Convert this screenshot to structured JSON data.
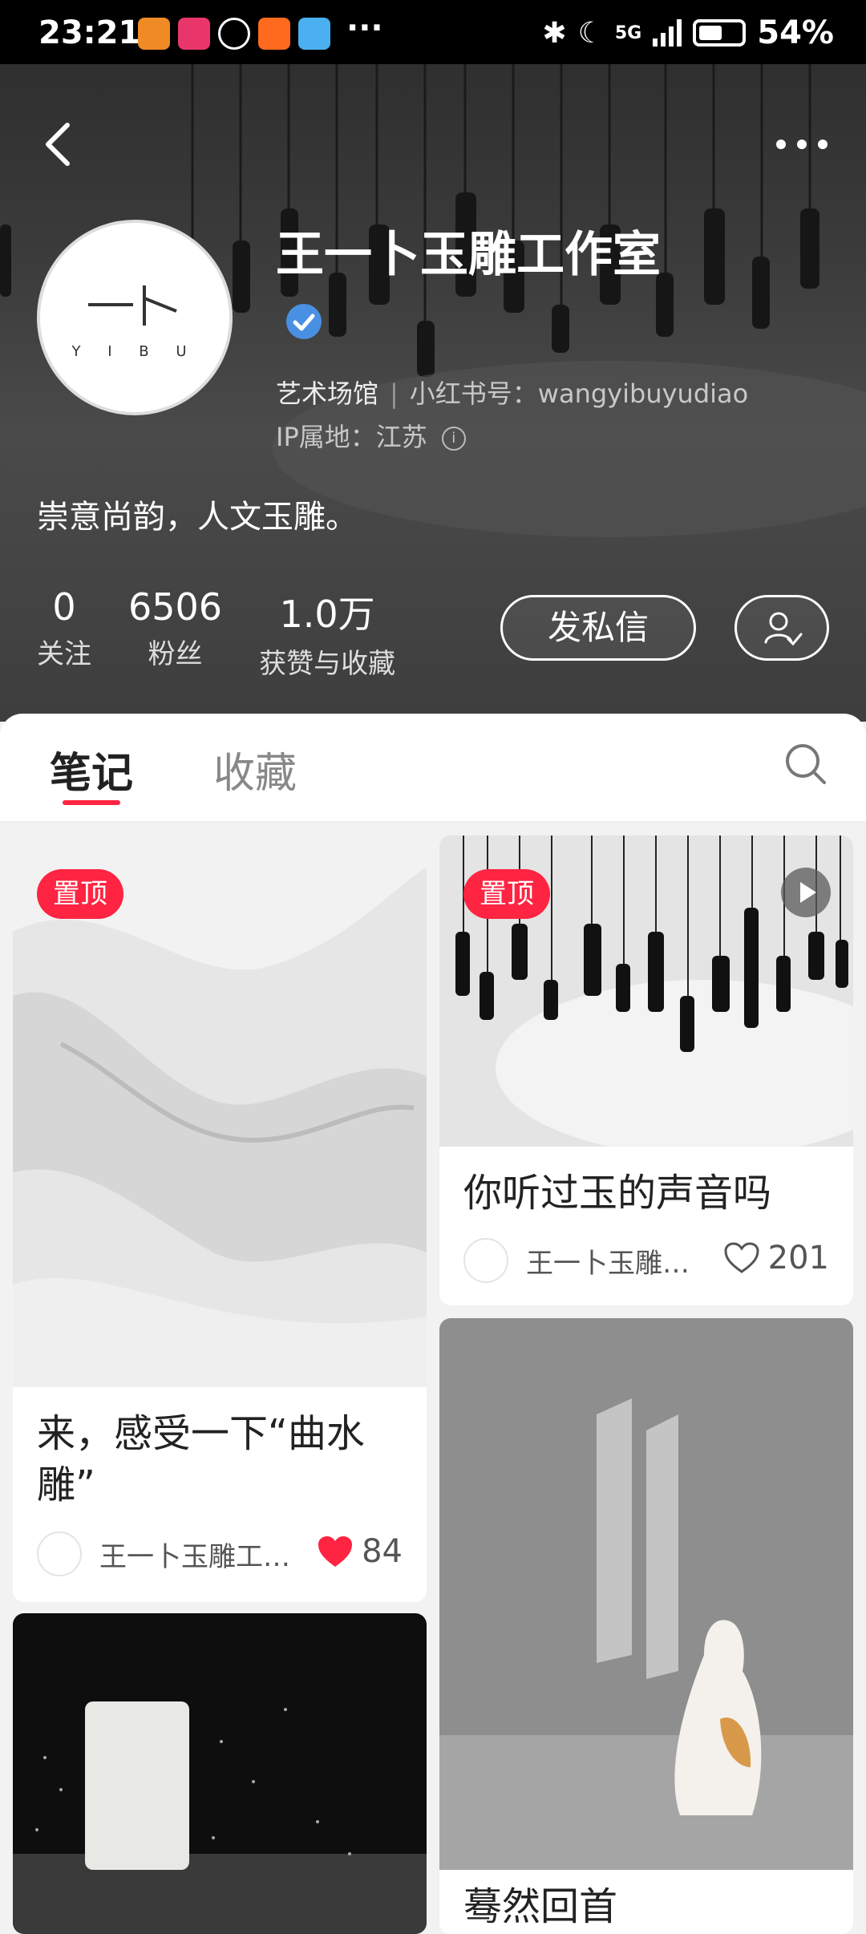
{
  "status_bar": {
    "time": "23:21",
    "more": "···",
    "network": "5G",
    "battery": "54%"
  },
  "profile": {
    "name": "王一卜玉雕工作室",
    "logo_text": "Y I B U",
    "category": "艺术场馆",
    "id_label": "小红书号：wangyibuyudiao",
    "ip_location": "IP属地：江苏",
    "bio": "崇意尚韵，人文玉雕。",
    "stats": [
      {
        "num": "0",
        "label": "关注"
      },
      {
        "num": "6506",
        "label": "粉丝"
      },
      {
        "num": "1.0万",
        "label": "获赞与收藏"
      }
    ],
    "message_button": "发私信"
  },
  "tabs": {
    "notes": "笔记",
    "collections": "收藏"
  },
  "notes": [
    {
      "pin": "置顶",
      "title": "来，感受一下“曲水雕”",
      "author": "王一卜玉雕工…",
      "likes": "84",
      "liked": true
    },
    {
      "pin": "置顶",
      "title": "你听过玉的声音吗",
      "author": "王一卜玉雕…",
      "likes": "201",
      "liked": false,
      "video": true
    },
    {
      "title": "蓦然回首"
    }
  ],
  "colors": {
    "accent": "#ff2442",
    "hero_bg": "#3a3a3a"
  }
}
